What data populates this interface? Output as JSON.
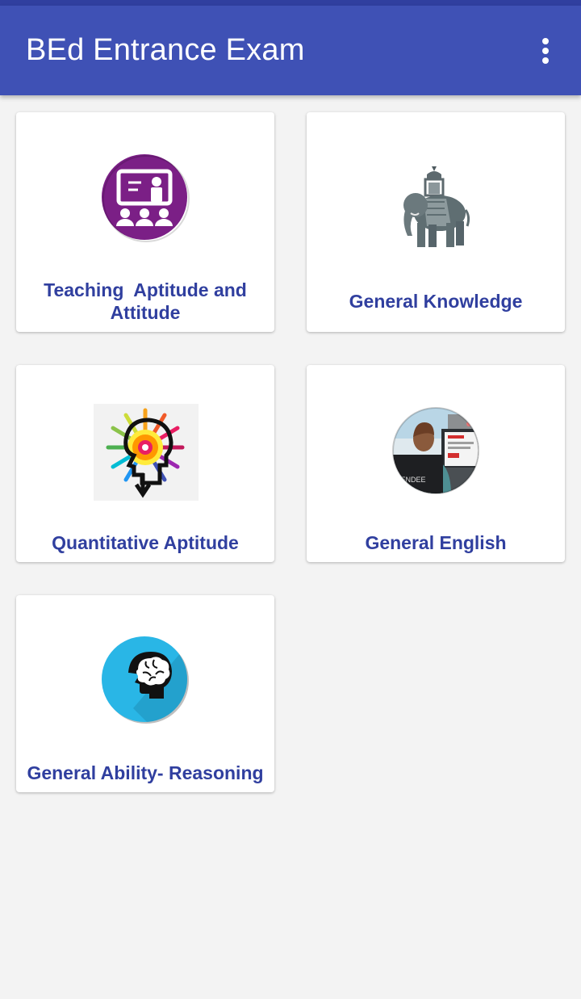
{
  "app": {
    "title": "BEd Entrance Exam",
    "menu_icon": "more-vert-icon",
    "colors": {
      "primary": "#3f51b5",
      "primary_dark": "#303f9f",
      "label": "#303f9f",
      "background": "#f3f3f3"
    }
  },
  "categories": [
    {
      "label": "Teaching  Aptitude and Attitude",
      "icon": "teacher-classroom-icon"
    },
    {
      "label": "General Knowledge",
      "icon": "elephant-icon"
    },
    {
      "label": "Quantitative Aptitude",
      "icon": "color-head-arrows-icon"
    },
    {
      "label": "General English",
      "icon": "person-at-computer-icon"
    },
    {
      "label": "General Ability- Reasoning",
      "icon": "head-brain-icon"
    }
  ]
}
